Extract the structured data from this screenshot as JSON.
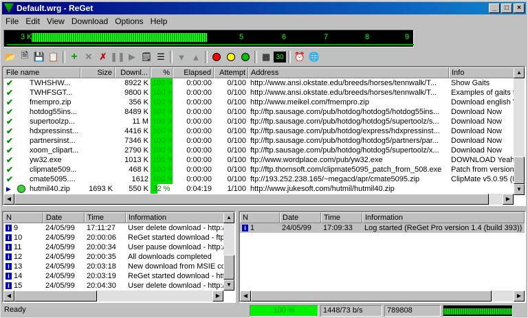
{
  "window": {
    "title": "Default.wrg - ReGet",
    "buttons": [
      "_",
      "□",
      "×"
    ]
  },
  "menu": [
    "File",
    "Edit",
    "View",
    "Download",
    "Options",
    "Help"
  ],
  "meter": {
    "labels": [
      "3 K",
      "5",
      "6",
      "7",
      "8",
      "9"
    ]
  },
  "toolbar": {
    "icons": [
      "open-folder-icon",
      "import-icon",
      "save-icon",
      "clipboard-icon",
      "add-icon",
      "delete-icon",
      "delete-completed-icon",
      "pause-icon",
      "start-icon",
      "properties-icon",
      "list-icon",
      "move-down-icon",
      "move-up-icon",
      "red-light-icon",
      "yellow-light-icon",
      "green-light-icon",
      "grid-icon",
      "counter-icon",
      "scheduler-icon",
      "globe-icon"
    ],
    "colors": {
      "red": "#ff0000",
      "yellow": "#ffff00",
      "green": "#00c000"
    },
    "counter": "30"
  },
  "downloads": {
    "headers": [
      "File name",
      "Size",
      "Downl...",
      "%",
      "Elapsed",
      "Attempt",
      "Address",
      "Info"
    ],
    "rows": [
      [
        "TWHSHW...",
        "",
        "8922 K",
        "100 %",
        "0:00:00",
        "0/100",
        "http://www.ansi.okstate.edu/breeds/horses/tennwalk/T...",
        "Show Gaits"
      ],
      [
        "TWHFSGT...",
        "",
        "9800 K",
        "100 %",
        "0:00:00",
        "0/100",
        "http://www.ansi.okstate.edu/breeds/horses/tennwalk/T...",
        "Examples of gaits fo"
      ],
      [
        "fmempro.zip",
        "",
        "356 K",
        "100 %",
        "0:00:00",
        "0/100",
        "http://www.meikel.com/fmempro.zip",
        "Download english V"
      ],
      [
        "hotdog55ins...",
        "",
        "8489 K",
        "100 %",
        "0:00:00",
        "0/100",
        "ftp://ftp.sausage.com/pub/hotdog/hotdog5/hotdog55ins...",
        "Download Now"
      ],
      [
        "supertoolzp...",
        "",
        "11 M",
        "100 %",
        "0:00:00",
        "0/100",
        "ftp://ftp.sausage.com/pub/hotdog/hotdog5/supertoolz/s...",
        "Download Now"
      ],
      [
        "hdxpressinst...",
        "",
        "4416 K",
        "100 %",
        "0:00:00",
        "0/100",
        "ftp://ftp.sausage.com/pub/hotdog/express/hdxpressinst...",
        "Download Now"
      ],
      [
        "partnersinst...",
        "",
        "7346 K",
        "100 %",
        "0:00:00",
        "0/100",
        "ftp://ftp.sausage.com/pub/hotdog/hotdog5/partners/par...",
        "Download Now"
      ],
      [
        "xoom_clipart...",
        "",
        "2790 K",
        "100 %",
        "0:00:00",
        "0/100",
        "ftp://ftp.sausage.com/pub/hotdog/hotdog5/supertoolz/x...",
        "Download Now"
      ],
      [
        "yw32.exe",
        "",
        "1013 K",
        "100 %",
        "0:00:00",
        "0/100",
        "ftp://www.wordplace.com/pub/yw32.exe",
        "DOWNLOAD Yeah"
      ],
      [
        "clipmate509...",
        "",
        "468 K",
        "100 %",
        "0:00:00",
        "0/100",
        "ftp://ftp.thornsoft.com/clipmate5095_patch_from_508.exe",
        "Patch from version !"
      ],
      [
        "cmate5095....",
        "",
        "1612",
        "100 %",
        "0:00:00",
        "0/100",
        "ftp://193.252.238.165/~megacd/apr/cmate5095.zip",
        "ClipMate v5.0.95 (B"
      ],
      [
        "hutmil40.zip",
        "1693 K",
        "550 K",
        "32 %",
        "0:04:19",
        "1/100",
        "http://www.jukesoft.com/hutmil/hutmil40.zip",
        ""
      ]
    ]
  },
  "log_left": {
    "headers": [
      "N",
      "Date",
      "Time",
      "Information"
    ],
    "rows": [
      [
        "9",
        "24/05/99",
        "17:11:27",
        "User delete download - http://"
      ],
      [
        "10",
        "24/05/99",
        "20:00:06",
        "ReGet started download - ftp://"
      ],
      [
        "11",
        "24/05/99",
        "20:00:34",
        "User pause download - http://f"
      ],
      [
        "12",
        "24/05/99",
        "20:00:35",
        "All downloads completed"
      ],
      [
        "13",
        "24/05/99",
        "20:03:18",
        "New download from MSIE cor"
      ],
      [
        "14",
        "24/05/99",
        "20:03:19",
        "ReGet started download - http"
      ],
      [
        "15",
        "24/05/99",
        "20:04:30",
        "User delete download - http://"
      ]
    ]
  },
  "log_right": {
    "headers": [
      "N",
      "Date",
      "Time",
      "Information"
    ],
    "rows": [
      [
        "1",
        "24/05/99",
        "17:09:33",
        "Log started (ReGet Pro version 1.4 (build 393))"
      ]
    ]
  },
  "status": {
    "text": "Ready",
    "percent": "100 %",
    "progress": 1.0,
    "speed": "1448/73 b/s",
    "bytes": "789808"
  }
}
